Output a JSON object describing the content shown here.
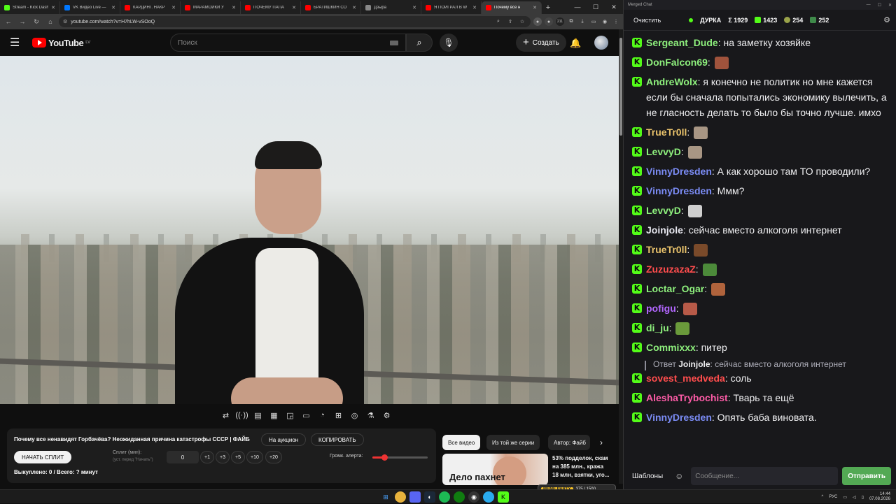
{
  "browser": {
    "tabs": [
      {
        "title": "Stream - Kick Dash",
        "color": "#53fc18",
        "active": false
      },
      {
        "title": "VK Видео Live —",
        "color": "#0077ff",
        "active": false
      },
      {
        "title": "КАРДИНГ. НАКР",
        "color": "#ff0000",
        "active": false
      },
      {
        "title": "МАРАМОЙКИ У",
        "color": "#ff0000",
        "active": false
      },
      {
        "title": "ПОЧЕМУ ПАПА",
        "color": "#ff0000",
        "active": false
      },
      {
        "title": "БРАТИШКИН СО",
        "color": "#ff0000",
        "active": false
      },
      {
        "title": "Дзыра",
        "color": "#888888",
        "active": false
      },
      {
        "title": "Я ПОИГРАЛ В W",
        "color": "#ff0000",
        "active": false
      },
      {
        "title": "Почему все н",
        "color": "#ff0000",
        "active": true
      }
    ],
    "url": "youtube.com/watch?v=H7hLW-vSOoQ",
    "ext_badge": "211"
  },
  "youtube": {
    "logo_text": "YouTube",
    "region": "LV",
    "search_placeholder": "Поиск",
    "create_label": "Создать"
  },
  "panel": {
    "title": "Почему все ненавидят Горбачёва? Неожиданная причина катастрофы СССР | ФАЙБ",
    "auction_label": "На аукцион",
    "copy_label": "КОПИРОВАТЬ",
    "start_split_label": "НАЧАТЬ СПЛИТ",
    "split_label": "Сплит (мин):",
    "split_hint": "(уст. перед \"Начать\")",
    "split_value": "0",
    "steps": [
      "+1",
      "+3",
      "+5",
      "+10",
      "+20"
    ],
    "alert_volume_label": "Громк. алерта:",
    "alert_volume_level": 0.22,
    "bought_text": "Выкуплено: 0 / Всего: ? минут"
  },
  "recs": {
    "chips": [
      "Все видео",
      "Из той же серии",
      "Автор: Файб"
    ],
    "thumb_text": "Дело пахнет",
    "meta_lines": [
      "53% подделок, скам",
      "на 385 млн., кража",
      "18 млн, взятки, уго..."
    ],
    "badge_label": "MEME PARTY",
    "badge_count": "375 / 1500"
  },
  "chat": {
    "window_title": "Merged Chat",
    "clear_label": "Очистить",
    "stream_name": "ДУРКА",
    "stat_total": "Σ 1929",
    "stat_kick": "1423",
    "stat_b": "254",
    "stat_c": "252",
    "templates_label": "Шаблоны",
    "input_placeholder": "Сообщение...",
    "send_label": "Отправить",
    "messages": [
      {
        "user": "Sergeant_Dude",
        "color": "#8ef07d",
        "text": "на заметку хозяйке"
      },
      {
        "user": "DonFalcon69",
        "color": "#8ef07d",
        "text": "",
        "emote": "#a0533c"
      },
      {
        "user": "AndreWolx",
        "color": "#8ef07d",
        "text": "я конечно не политик но мне кажется если бы сначала попытались экономику вылечить, а не гласность делать то было бы точно лучше. имхо"
      },
      {
        "user": "TrueTr0ll",
        "color": "#e9c26b",
        "text": "",
        "emote": "#a89684"
      },
      {
        "user": "LevvyD",
        "color": "#8ef07d",
        "text": "",
        "emote": "#a89684"
      },
      {
        "user": "VinnyDresden",
        "color": "#7b8cf5",
        "text": "А как хорошо там ТО проводили?"
      },
      {
        "user": "VinnyDresden",
        "color": "#7b8cf5",
        "text": "Ммм?"
      },
      {
        "user": "LevvyD",
        "color": "#8ef07d",
        "text": "",
        "emote": "#cfcfcf"
      },
      {
        "user": "Joinjole",
        "color": "#e8e8f0",
        "text": "сейчас вместо алкоголя интернет"
      },
      {
        "user": "TrueTr0ll",
        "color": "#e9c26b",
        "text": "",
        "emote": "#7a4a2a"
      },
      {
        "user": "ZuzuzazaZ",
        "color": "#ff4d4d",
        "text": "",
        "emote": "#4c8a3a"
      },
      {
        "user": "Loctar_Ogar",
        "color": "#8ef07d",
        "text": "",
        "emote": "#b0633c"
      },
      {
        "user": "pofigu",
        "color": "#b266ff",
        "text": "",
        "emote": "#b75a48"
      },
      {
        "user": "di_ju",
        "color": "#8ef07d",
        "text": "",
        "emote": "#6a9a3b"
      },
      {
        "user": "Commixxx",
        "color": "#8ef07d",
        "text": "питер"
      },
      {
        "user": "sovest_medveda",
        "color": "#ff4d4d",
        "text": "соль",
        "reply_prefix": "Ответ",
        "reply_to": "Joinjole",
        "reply_text": "сейчас вместо алкоголя интернет"
      },
      {
        "user": "AleshaTrybochist",
        "color": "#ff5ca8",
        "text": "Тварь та ещё"
      },
      {
        "user": "VinnyDresden",
        "color": "#7b8cf5",
        "text": "Опять баба виновата."
      }
    ]
  },
  "taskbar": {
    "lang": "РУС",
    "time": "14:44",
    "date": "07.08.2026"
  }
}
